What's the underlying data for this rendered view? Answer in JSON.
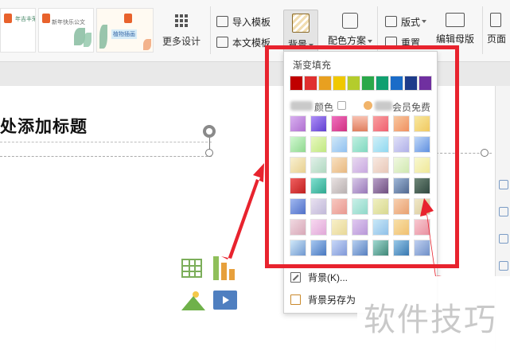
{
  "ribbon": {
    "templates": [
      {
        "caption": "年吉丰荣公文"
      },
      {
        "caption": "新年快乐公文"
      },
      {
        "caption": "植物插画"
      }
    ],
    "more_design_label": "更多设计",
    "import_template_label": "导入模板",
    "text_template_label": "本文模板",
    "background_label": "背景",
    "color_scheme_label": "配色方案",
    "layout_label": "版式",
    "reset_label": "重置",
    "edit_master_label": "编辑母版",
    "page_label": "页面"
  },
  "slide": {
    "title_text": "处添加标题"
  },
  "background_dropdown": {
    "gradient_fill_label": "渐变填充",
    "gradient_colors": [
      "#c00000",
      "#e03030",
      "#e8a020",
      "#f0c800",
      "#b4cc2c",
      "#2aa84a",
      "#10a070",
      "#1a6cc8",
      "#1e3c8a",
      "#7030a0"
    ],
    "more_colors_label": "颜色",
    "vip_free_label": "会员免费",
    "texture_swatches": [
      "linear-gradient(135deg,#d8b0f0,#b070d0)",
      "linear-gradient(135deg,#b090f8,#6040d0)",
      "linear-gradient(135deg,#f070c0,#d03080)",
      "linear-gradient(180deg,#f8c0b0,#e08060)",
      "linear-gradient(135deg,#f8a0a0,#f06070)",
      "linear-gradient(135deg,#f8c8a0,#f09060)",
      "linear-gradient(135deg,#f8e8a0,#f0c860)",
      "linear-gradient(135deg,#d0f8d0,#90d890)",
      "linear-gradient(135deg,#e8f8c0,#c0e880)",
      "linear-gradient(135deg,#d0e8f8,#90c0f0)",
      "linear-gradient(135deg,#c0f0e0,#80d8c0)",
      "linear-gradient(135deg,#d0f0f8,#90d8f0)",
      "linear-gradient(135deg,#e0e0f8,#b0b0e8)",
      "linear-gradient(135deg,#c0d8f8,#6090e0)",
      "linear-gradient(135deg,#f8f0d0,#e8d090)",
      "linear-gradient(135deg,#e0f0e8,#b0d8c0)",
      "linear-gradient(135deg,#f8e0c0,#e8b880)",
      "linear-gradient(135deg,#e8d8f0,#c8a8e0)",
      "linear-gradient(135deg,#f8e8e0,#e8c8b8)",
      "linear-gradient(135deg,#f0f8e0,#d0e8b0)",
      "linear-gradient(135deg,#f8f8d0,#f0e898)",
      "linear-gradient(135deg,#f06060,#c02020)",
      "linear-gradient(135deg,#80e0d0,#30a890)",
      "linear-gradient(135deg,#e8e0e0,#b8b0b0)",
      "linear-gradient(135deg,#d8c8e8,#9878b8)",
      "linear-gradient(135deg,#b8a0c8,#705080)",
      "linear-gradient(135deg,#a0b8d8,#506890)",
      "linear-gradient(135deg,#708878,#304840)",
      "linear-gradient(135deg,#a0b8f0,#5070c8)",
      "linear-gradient(135deg,#e8e0f0,#c0b8d8)",
      "linear-gradient(135deg,#f8c8c0,#e89890)",
      "linear-gradient(135deg,#c8f0e8,#90d8c8)",
      "linear-gradient(135deg,#f0f0c0,#d8d890)",
      "linear-gradient(135deg,#f8d0b0,#e8a070)",
      "linear-gradient(135deg,#f0e8c8,#d8c898)",
      "linear-gradient(135deg,#f0d8e0,#d8a8b8)",
      "linear-gradient(135deg,#f8d8f0,#e0a8d8)",
      "linear-gradient(135deg,#f8f0c8,#e8d898)",
      "linear-gradient(135deg,#e0c8f0,#b898d8)",
      "linear-gradient(135deg,#c8e8f8,#90c0e8)",
      "linear-gradient(135deg,#f8e0a8,#f0c070)",
      "linear-gradient(135deg,#f8c8d0,#e890a0)",
      "linear-gradient(135deg,#d0e8f8,#7098d0)",
      "linear-gradient(135deg,#a8c8f0,#4878c0)",
      "linear-gradient(135deg,#c8d8f8,#8098d8)",
      "linear-gradient(135deg,#b8d0f0,#5880c0)",
      "linear-gradient(135deg,#a0d8d0,#408878)",
      "linear-gradient(135deg,#98c8e8,#3878b0)",
      "linear-gradient(135deg,#c0d0f0,#7090c8)"
    ],
    "menu_background_label": "背景(K)...",
    "menu_save_background_label": "背景另存为"
  },
  "watermark_text": "软件技巧",
  "colors": {
    "highlight_red": "#e8232e",
    "ribbon_bg": "#f7f7f7"
  }
}
